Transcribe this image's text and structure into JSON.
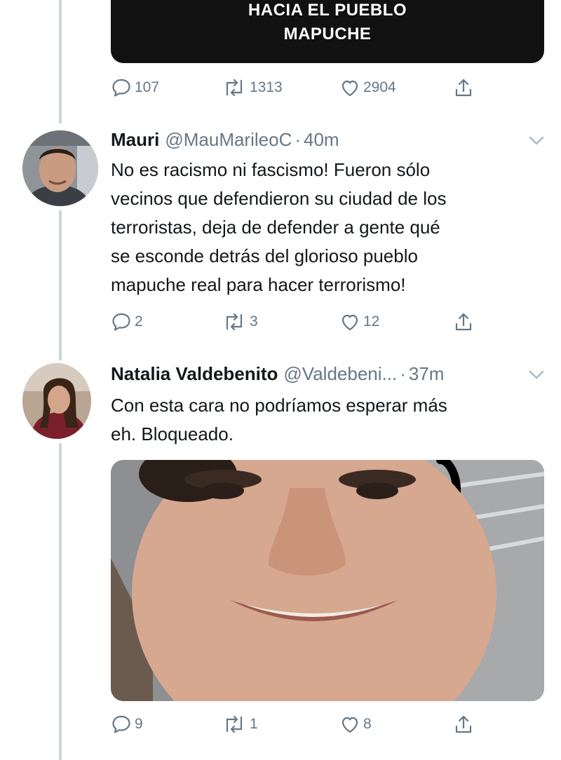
{
  "quoted_card": {
    "line1": "HACIA EL PUEBLO",
    "line2": "MAPUCHE"
  },
  "top_tweet_actions": {
    "replies": "107",
    "retweets": "1313",
    "likes": "2904"
  },
  "tweets": [
    {
      "display_name": "Mauri",
      "handle": "@MauMarileoC",
      "separator": "·",
      "time": "40m",
      "text": "No es racismo ni fascismo! Fueron sólo\nvecinos que defendieron su ciudad de los\nterroristas, deja de defender a gente qué\nse esconde detrás del glorioso pueblo\nmapuche real para hacer terrorismo!",
      "replies": "2",
      "retweets": "3",
      "likes": "12"
    },
    {
      "display_name": "Natalia Valdebenito",
      "handle": "@Valdebeni...",
      "separator": "·",
      "time": "37m",
      "text": "Con esta cara no podríamos esperar más\neh. Bloqueado.",
      "replies": "9",
      "retweets": "1",
      "likes": "8"
    }
  ],
  "icons": {
    "reply": "reply-icon",
    "retweet": "retweet-icon",
    "like": "like-icon",
    "share": "share-icon",
    "caret": "chevron-down-icon"
  },
  "colors": {
    "text": "#14171a",
    "secondary": "#657786",
    "thread_line": "#ccd6dd",
    "card_bg": "#111111"
  }
}
